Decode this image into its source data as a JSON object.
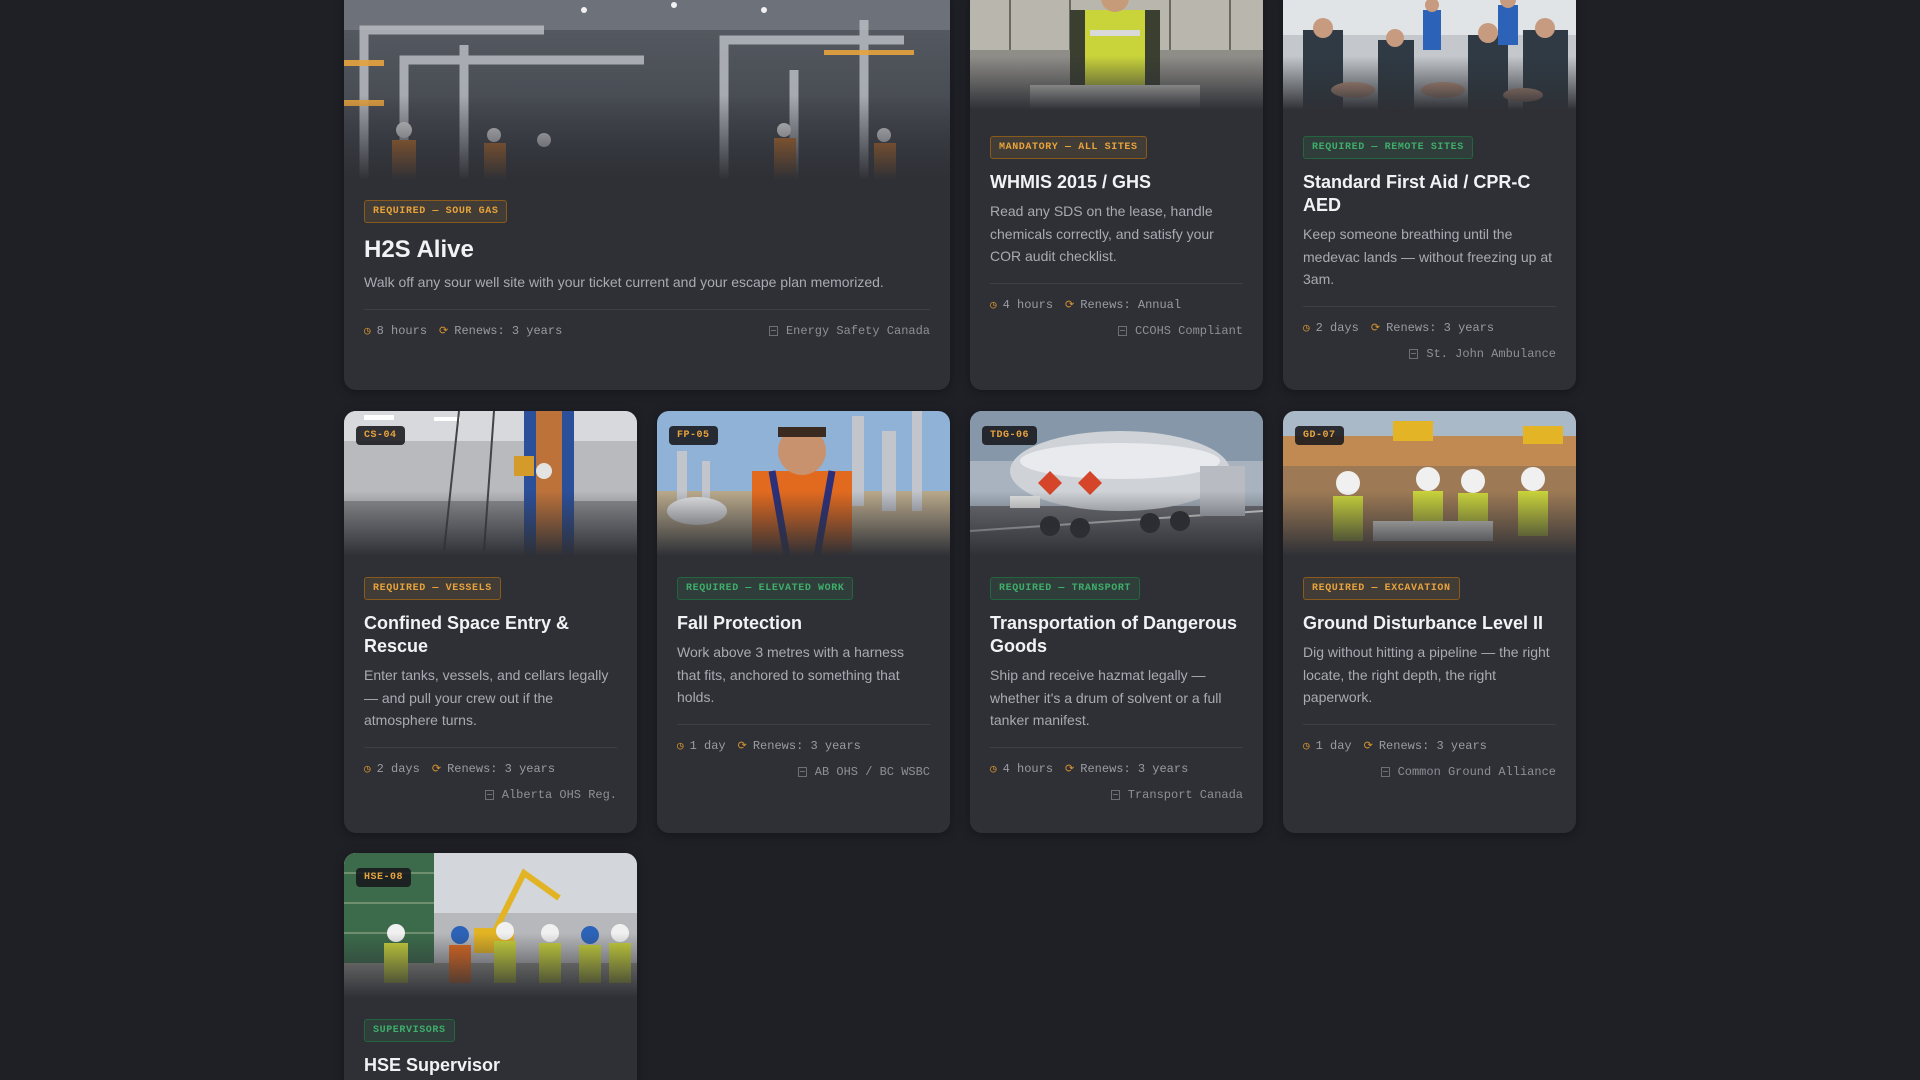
{
  "colors": {
    "background": "#1f2026",
    "card": "#2e3036",
    "accent_orange": "#e8a33d",
    "accent_green": "#3fae6a"
  },
  "courses": [
    {
      "id": "h2s",
      "tag": "REQUIRED — SOUR GAS",
      "tag_color": "orange",
      "title": "H2S Alive",
      "description": "Walk off any sour well site with your ticket current and your escape plan memorized.",
      "duration": "8 hours",
      "renews": "Renews: 3 years",
      "provider": "Energy Safety Canada",
      "image": "industrial-plant-photo"
    },
    {
      "id": "whmis",
      "tag": "MANDATORY — ALL SITES",
      "tag_color": "orange",
      "title": "WHMIS 2015 / GHS",
      "description": "Read any SDS on the lease, handle chemicals correctly, and satisfy your COR audit checklist.",
      "duration": "4 hours",
      "renews": "Renews: Annual",
      "provider": "CCOHS Compliant",
      "image": "worker-hi-vis-photo"
    },
    {
      "id": "firstaid",
      "tag": "REQUIRED — REMOTE SITES",
      "tag_color": "green",
      "title": "Standard First Aid / CPR-C AED",
      "description": "Keep someone breathing until the medevac lands — without freezing up at 3am.",
      "duration": "2 days",
      "renews": "Renews: 3 years",
      "provider": "St. John Ambulance",
      "image": "cpr-class-photo"
    },
    {
      "id": "confined",
      "code": "CS-04",
      "tag": "REQUIRED — VESSELS",
      "tag_color": "orange",
      "title": "Confined Space Entry & Rescue",
      "description": "Enter tanks, vessels, and cellars legally — and pull your crew out if the atmosphere turns.",
      "duration": "2 days",
      "renews": "Renews: 3 years",
      "provider": "Alberta OHS Reg.",
      "image": "harness-worker-photo"
    },
    {
      "id": "fall",
      "code": "FP-05",
      "tag": "REQUIRED — ELEVATED WORK",
      "tag_color": "green",
      "title": "Fall Protection",
      "description": "Work above 3 metres with a harness that fits, anchored to something that holds.",
      "duration": "1 day",
      "renews": "Renews: 3 years",
      "provider": "AB OHS / BC WSBC",
      "image": "refinery-worker-photo"
    },
    {
      "id": "tdg",
      "code": "TDG-06",
      "tag": "REQUIRED — TRANSPORT",
      "tag_color": "green",
      "title": "Transportation of Dangerous Goods",
      "description": "Ship and receive hazmat legally — whether it's a drum of solvent or a full tanker manifest.",
      "duration": "4 hours",
      "renews": "Renews: 3 years",
      "provider": "Transport Canada",
      "image": "tanker-truck-photo"
    },
    {
      "id": "ground",
      "code": "GD-07",
      "tag": "REQUIRED — EXCAVATION",
      "tag_color": "orange",
      "title": "Ground Disturbance Level II",
      "description": "Dig without hitting a pipeline — the right locate, the right depth, the right paperwork.",
      "duration": "1 day",
      "renews": "Renews: 3 years",
      "provider": "Common Ground Alliance",
      "image": "excavation-crew-photo"
    },
    {
      "id": "hse",
      "code": "HSE-08",
      "tag": "SUPERVISORS",
      "tag_color": "green",
      "title": "HSE Supervisor",
      "image": "site-supervisors-photo"
    }
  ]
}
